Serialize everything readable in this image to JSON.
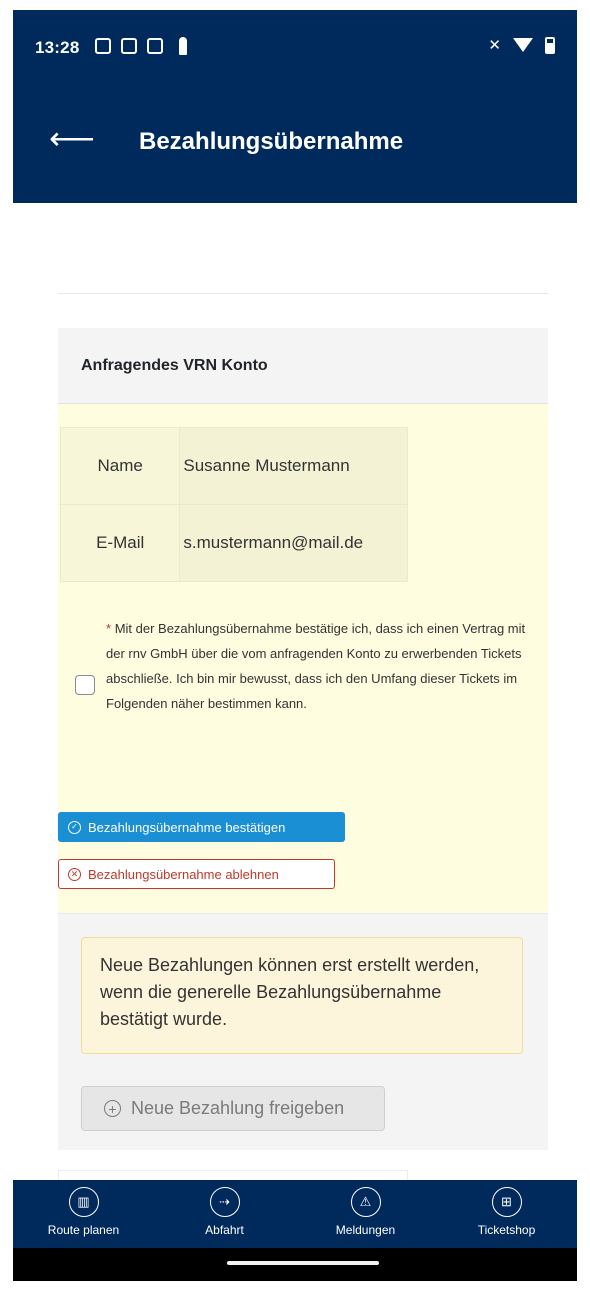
{
  "status_bar": {
    "time": "13:28",
    "left_icons": [
      "teams-icon",
      "outlook-icon",
      "office-icon",
      "person-icon"
    ],
    "right_icons": [
      "mute-icon",
      "wifi-icon",
      "battery-icon"
    ]
  },
  "header": {
    "back_label": "⟵",
    "title": "Bezahlungsübernahme"
  },
  "card": {
    "title": "Anfragendes VRN Konto",
    "account": [
      {
        "label": "Name",
        "value": "Susanne Mustermann"
      },
      {
        "label": "E-Mail",
        "value": "s.mustermann@mail.de"
      }
    ],
    "consent": {
      "required_mark": "*",
      "text": "Mit der Bezahlungsübernahme bestätige ich, dass ich einen Vertrag mit der rnv GmbH über die vom anfragenden Konto zu erwerbenden Tickets abschließe. Ich bin mir bewusst, dass ich den Umfang dieser Tickets im Folgenden näher bestimmen kann.",
      "checked": false
    },
    "confirm_label": "Bezahlungsübernahme bestätigen",
    "reject_label": "Bezahlungsübernahme ablehnen",
    "warning": "Neue Bezahlungen können erst erstellt werden, wenn die generelle Bezahlungsübernahme bestätigt wurde.",
    "new_payment_label": "Neue Bezahlung freigeben"
  },
  "colors": {
    "primary_dark": "#002a5c",
    "confirm": "#1a8fd3",
    "reject": "#c0392b",
    "highlight": "#fefde0",
    "warning_bg": "#fdf4dc"
  },
  "bottom_nav": [
    {
      "label": "Route planen",
      "icon": "map-icon"
    },
    {
      "label": "Abfahrt",
      "icon": "departure-icon"
    },
    {
      "label": "Meldungen",
      "icon": "warning-icon"
    },
    {
      "label": "Ticketshop",
      "icon": "cart-icon"
    }
  ]
}
